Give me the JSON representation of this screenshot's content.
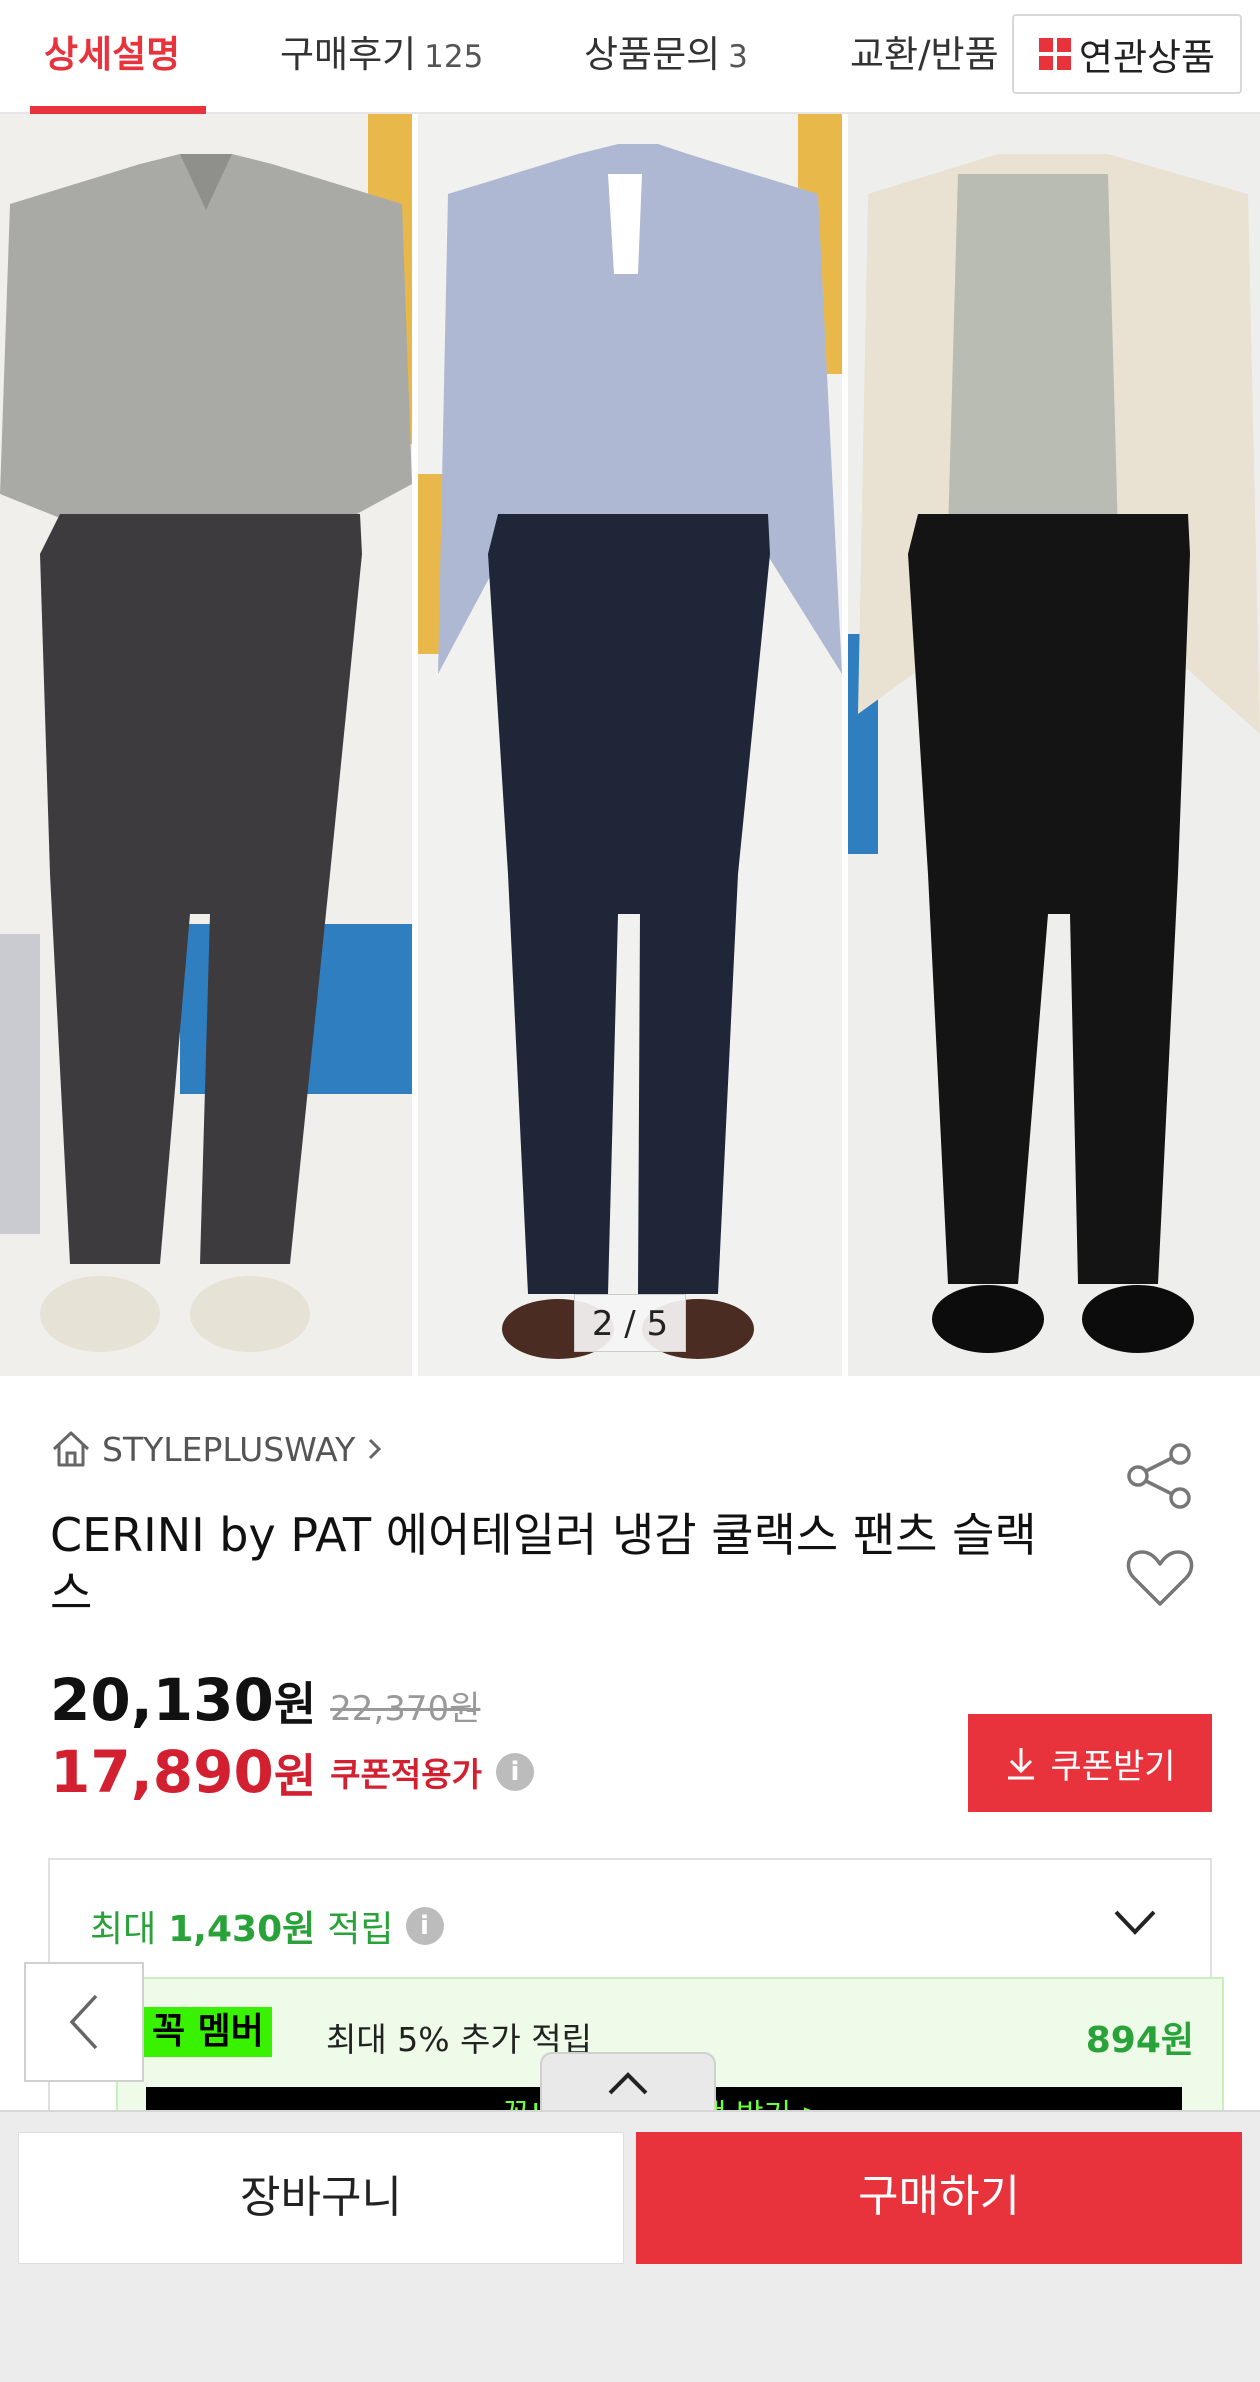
{
  "tabs": [
    {
      "label": "상세설명",
      "count": ""
    },
    {
      "label": "구매후기",
      "count": "125"
    },
    {
      "label": "상품문의",
      "count": "3"
    },
    {
      "label": "교환/반품",
      "count": ""
    }
  ],
  "related_button": {
    "label": "연관상품"
  },
  "carousel": {
    "pager": "2 / 5"
  },
  "product": {
    "shop_name": "STYLEPLUSWAY",
    "title": "CERINI by PAT 에어테일러 냉감 쿨랙스 팬츠 슬랙스",
    "price": "20,130",
    "price_unit": "원",
    "original_price": "22,370원",
    "coupon_price": "17,890",
    "coupon_price_unit": "원",
    "coupon_label": "쿠폰적용가",
    "coupon_button": "쿠폰받기"
  },
  "points": {
    "prefix": "최대",
    "amount": "1,430원",
    "suffix": "적립",
    "member_badge": "꼭 멤버",
    "member_text": "최대 5% 추가 적립",
    "member_amount": "894원",
    "black_banner": "꼭! 시작하고 혜택 받기 >"
  },
  "bottom_bar": {
    "cart": "장바구니",
    "buy": "구매하기"
  },
  "colors": {
    "accent": "#e8323c",
    "points_green": "#2aa23a",
    "member_green": "#39f200"
  }
}
